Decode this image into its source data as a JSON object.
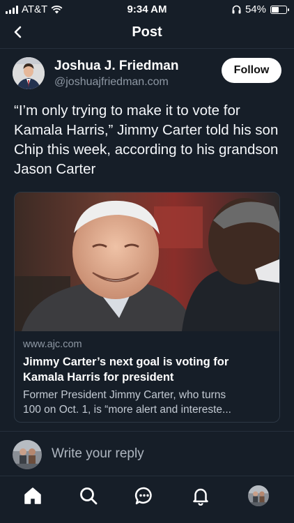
{
  "status_bar": {
    "carrier": "AT&T",
    "time": "9:34 AM",
    "battery_label": "54%",
    "battery_level": 0.54
  },
  "header": {
    "title": "Post"
  },
  "post": {
    "author_name": "Joshua J. Friedman",
    "author_handle": "@joshuajfriedman.com",
    "follow_label": "Follow",
    "text": "“I’m only trying to make it to vote for Kamala Harris,” Jimmy Carter told his son Chip this week, according to his grandson Jason Carter"
  },
  "link_card": {
    "domain": "www.ajc.com",
    "title": "Jimmy Carter’s next goal is voting for Kamala Harris for president",
    "description_line1": "Former President Jimmy Carter, who turns",
    "description_line2": "100 on Oct. 1, is  “more alert and intereste..."
  },
  "reply": {
    "placeholder": "Write your reply"
  },
  "colors": {
    "background": "#161e28",
    "divider": "#26303c",
    "secondary_text": "#8d97a3"
  },
  "tab_bar": {
    "icons": [
      "home-icon",
      "search-icon",
      "chat-icon",
      "bell-icon",
      "profile-avatar"
    ]
  }
}
